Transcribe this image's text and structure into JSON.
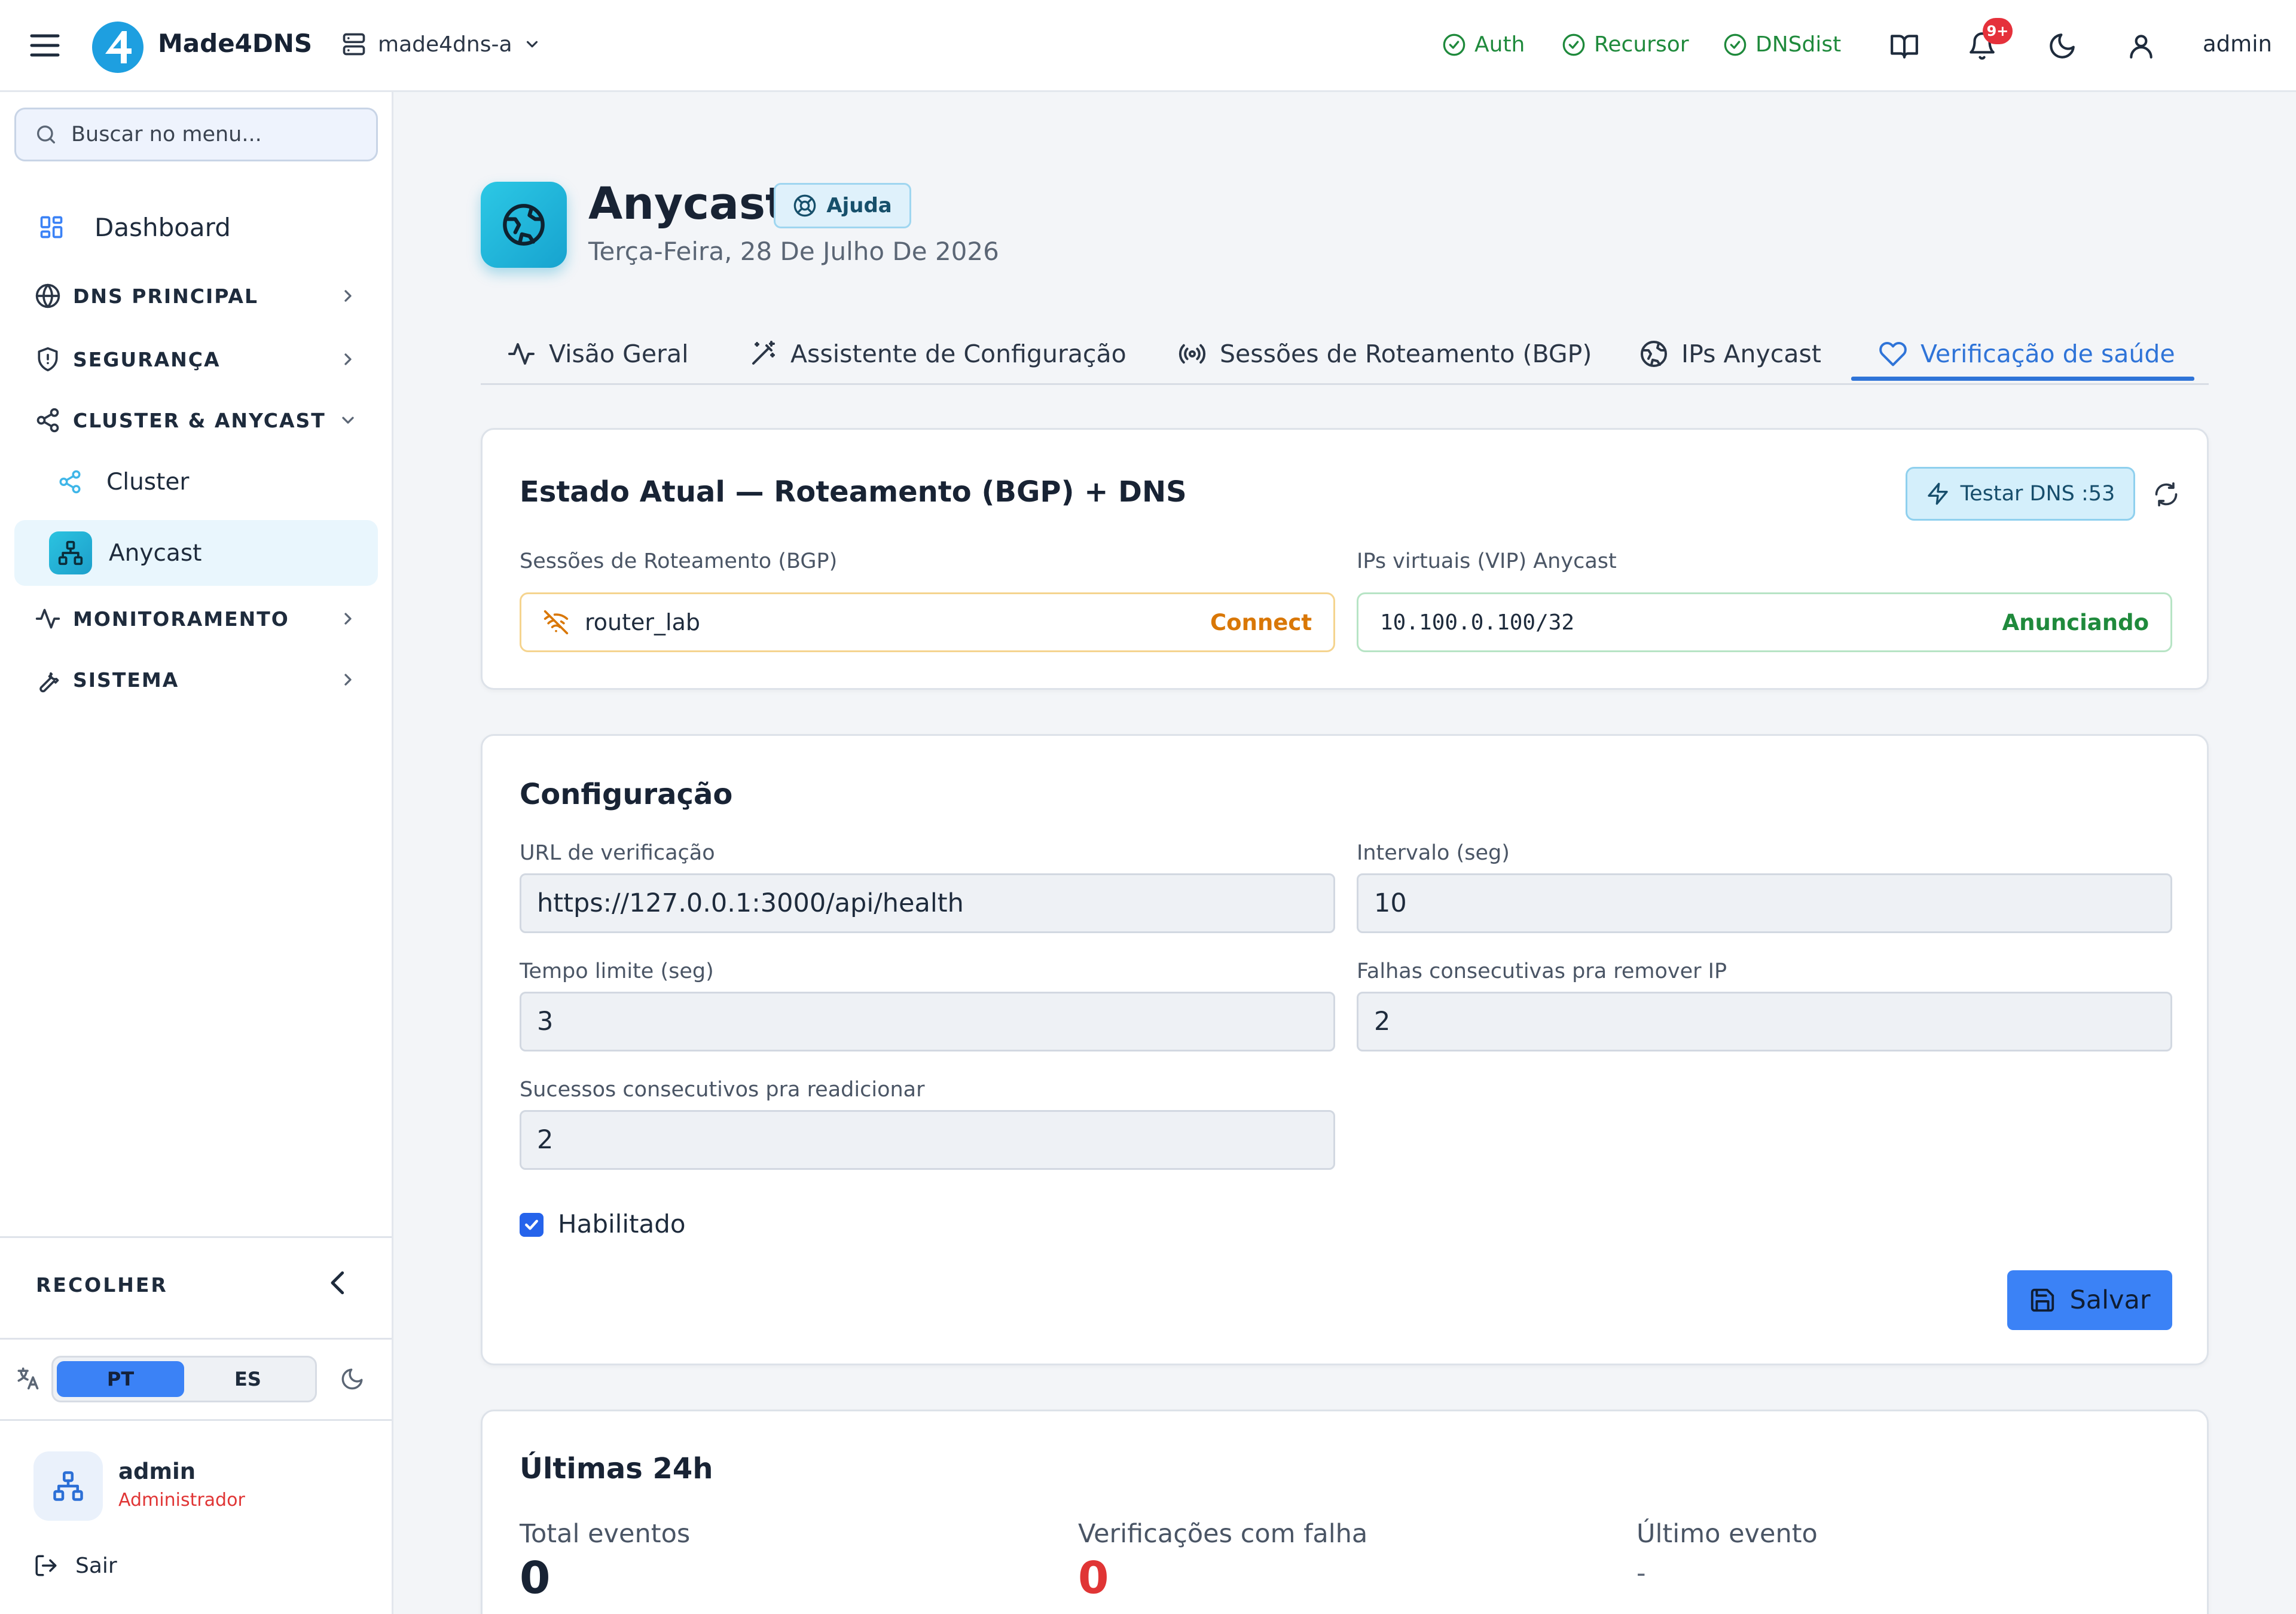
{
  "topbar": {
    "brand": "Made4DNS",
    "server": "made4dns-a",
    "services": [
      {
        "label": "Auth",
        "status": "ok"
      },
      {
        "label": "Recursor",
        "status": "ok"
      },
      {
        "label": "DNSdist",
        "status": "ok"
      }
    ],
    "notifications_badge": "9+",
    "user": "admin"
  },
  "sidebar": {
    "search_placeholder": "Buscar no menu...",
    "dashboard": "Dashboard",
    "sections": [
      {
        "label": "DNS PRINCIPAL",
        "icon": "globe-icon"
      },
      {
        "label": "SEGURANÇA",
        "icon": "shield-icon"
      },
      {
        "label": "CLUSTER & ANYCAST",
        "icon": "share-icon",
        "expanded": true,
        "items": [
          {
            "label": "Cluster"
          },
          {
            "label": "Anycast",
            "active": true
          }
        ]
      },
      {
        "label": "MONITORAMENTO",
        "icon": "activity-icon"
      },
      {
        "label": "SISTEMA",
        "icon": "wrench-icon"
      }
    ],
    "collapse_label": "RECOLHER",
    "languages": [
      "PT",
      "ES"
    ],
    "active_language": "PT",
    "user": {
      "name": "admin",
      "role": "Administrador"
    },
    "logout": "Sair"
  },
  "page": {
    "title": "Anycast",
    "help": "Ajuda",
    "date": "Terça-Feira, 28 De Julho De 2026",
    "tabs": [
      {
        "label": "Visão Geral"
      },
      {
        "label": "Assistente de Configuração"
      },
      {
        "label": "Sessões de Roteamento (BGP)"
      },
      {
        "label": "IPs Anycast"
      },
      {
        "label": "Verificação de saúde",
        "active": true
      }
    ]
  },
  "status_card": {
    "title": "Estado Atual — Roteamento (BGP) + DNS",
    "test_button": "Testar DNS :53",
    "bgp_label": "Sessões de Roteamento (BGP)",
    "bgp_session": {
      "name": "router_lab",
      "state": "Connect"
    },
    "vip_label": "IPs virtuais (VIP) Anycast",
    "vip": {
      "address": "10.100.0.100/32",
      "state": "Anunciando"
    }
  },
  "config_card": {
    "title": "Configuração",
    "fields": {
      "url": {
        "label": "URL de verificação",
        "value": "https://127.0.0.1:3000/api/health"
      },
      "interval": {
        "label": "Intervalo (seg)",
        "value": "10"
      },
      "timeout": {
        "label": "Tempo limite (seg)",
        "value": "3"
      },
      "fail_threshold": {
        "label": "Falhas consecutivas pra remover IP",
        "value": "2"
      },
      "success_threshold": {
        "label": "Sucessos consecutivos pra readicionar",
        "value": "2"
      }
    },
    "enabled": {
      "label": "Habilitado",
      "checked": true
    },
    "save_button": "Salvar"
  },
  "stats_card": {
    "title": "Últimas 24h",
    "total_events": {
      "label": "Total eventos",
      "value": "0"
    },
    "failed_checks": {
      "label": "Verificações com falha",
      "value": "0"
    },
    "last_event": {
      "label": "Último evento",
      "value": "-"
    }
  },
  "colors": {
    "accent": "#3b82f6",
    "ok": "#1f8a3c",
    "warning": "#d97706",
    "danger": "#e03535",
    "brand_cyan": "#22b8dc"
  }
}
